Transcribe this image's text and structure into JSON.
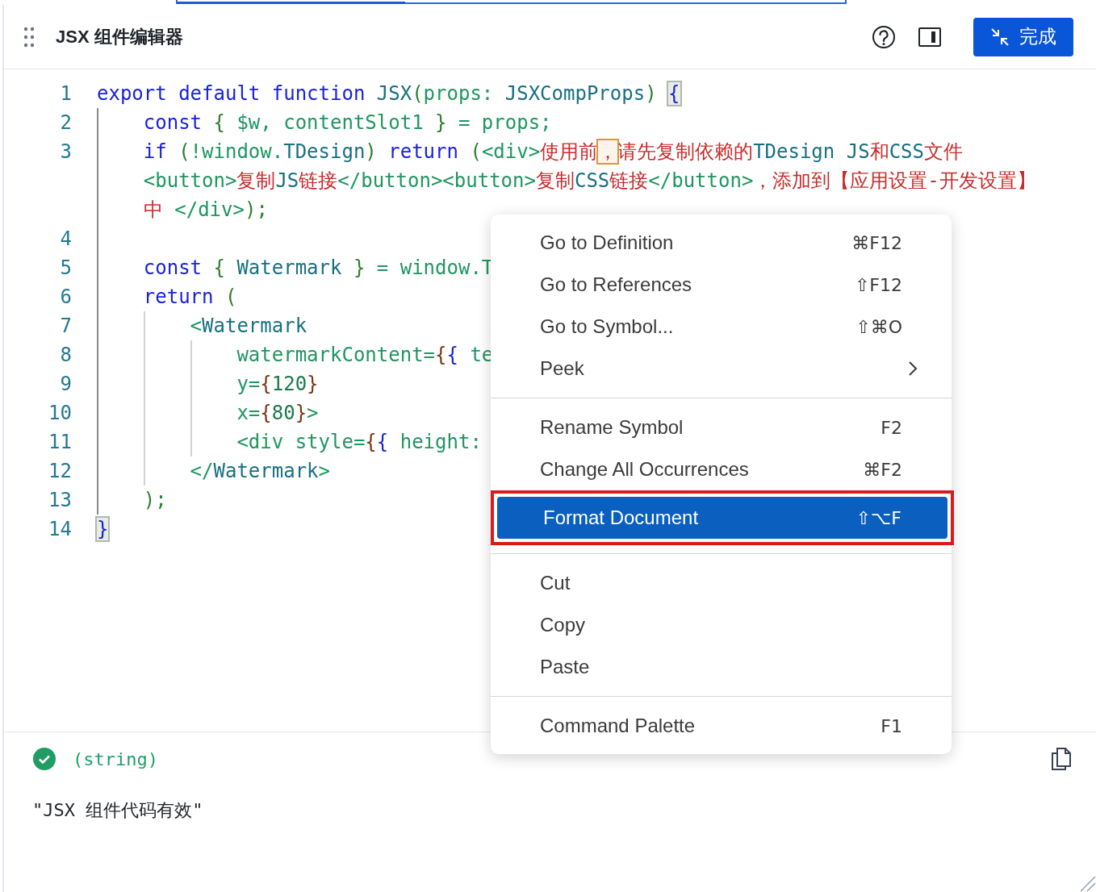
{
  "header": {
    "title": "JSX 组件编辑器",
    "done_button": "完成"
  },
  "editor": {
    "lines": [
      {
        "number": "1",
        "wraps": [
          {
            "tokens": [
              {
                "kind": "keyword",
                "text": "export default function "
              },
              {
                "kind": "name",
                "text": "JSX"
              },
              {
                "kind": "punct",
                "text": "("
              },
              {
                "kind": "code",
                "text": "props: "
              },
              {
                "kind": "name",
                "text": "JSXCompProps"
              },
              {
                "kind": "punct",
                "text": ") "
              },
              {
                "kind": "bracket-match",
                "text": "{"
              }
            ]
          }
        ]
      },
      {
        "number": "2",
        "wraps": [
          {
            "tokens": [
              {
                "kind": "keyword",
                "text": "    const"
              },
              {
                "kind": "punct",
                "text": " { "
              },
              {
                "kind": "code",
                "text": "$w, contentSlot1"
              },
              {
                "kind": "punct",
                "text": " }"
              },
              {
                "kind": "code",
                "text": " = props;"
              }
            ]
          }
        ]
      },
      {
        "number": "3",
        "wraps": [
          {
            "tokens": [
              {
                "kind": "keyword",
                "text": "    if"
              },
              {
                "kind": "punct",
                "text": " ("
              },
              {
                "kind": "code",
                "text": "!window."
              },
              {
                "kind": "name",
                "text": "TDesign"
              },
              {
                "kind": "punct",
                "text": ") "
              },
              {
                "kind": "keyword",
                "text": "return"
              },
              {
                "kind": "punct",
                "text": " ("
              },
              {
                "kind": "code",
                "text": "<div>"
              },
              {
                "kind": "text",
                "text": "使用前"
              },
              {
                "kind": "warning-char",
                "text": "，"
              },
              {
                "kind": "text",
                "text": "请先复制依赖的"
              },
              {
                "kind": "name",
                "text": "TDesign JS"
              },
              {
                "kind": "text",
                "text": "和"
              },
              {
                "kind": "name",
                "text": "CSS"
              },
              {
                "kind": "text",
                "text": "文件"
              }
            ]
          },
          {
            "tokens": [
              {
                "kind": "code",
                "text": "    <button>"
              },
              {
                "kind": "text",
                "text": "复制"
              },
              {
                "kind": "name",
                "text": "JS"
              },
              {
                "kind": "text",
                "text": "链接"
              },
              {
                "kind": "code",
                "text": "</button><button>"
              },
              {
                "kind": "text",
                "text": "复制"
              },
              {
                "kind": "name",
                "text": "CSS"
              },
              {
                "kind": "text",
                "text": "链接"
              },
              {
                "kind": "code",
                "text": "</button>"
              },
              {
                "kind": "text",
                "text": "，添加到【应用设置-开发设置】"
              }
            ]
          },
          {
            "tokens": [
              {
                "kind": "text",
                "text": "    中 "
              },
              {
                "kind": "code",
                "text": "</div>"
              },
              {
                "kind": "punct",
                "text": ");"
              }
            ]
          }
        ]
      },
      {
        "number": "4"
      },
      {
        "number": "5",
        "wraps": [
          {
            "tokens": [
              {
                "kind": "keyword",
                "text": "    const"
              },
              {
                "kind": "punct",
                "text": " { "
              },
              {
                "kind": "name",
                "text": "Watermark"
              },
              {
                "kind": "punct",
                "text": " }"
              },
              {
                "kind": "code",
                "text": " = window.T"
              }
            ]
          }
        ]
      },
      {
        "number": "6",
        "wraps": [
          {
            "tokens": [
              {
                "kind": "keyword",
                "text": "    return"
              },
              {
                "kind": "punct",
                "text": " ("
              }
            ]
          }
        ]
      },
      {
        "number": "7",
        "wraps": [
          {
            "tokens": [
              {
                "kind": "code",
                "text": "        <"
              },
              {
                "kind": "name",
                "text": "Watermark"
              }
            ]
          }
        ]
      },
      {
        "number": "8",
        "wraps": [
          {
            "tokens": [
              {
                "kind": "code",
                "text": "            watermarkContent="
              },
              {
                "kind": "outer-brace",
                "text": "{"
              },
              {
                "kind": "inner-brace",
                "text": "{"
              },
              {
                "kind": "code",
                "text": " te"
              }
            ]
          }
        ]
      },
      {
        "number": "9",
        "wraps": [
          {
            "tokens": [
              {
                "kind": "code",
                "text": "            y="
              },
              {
                "kind": "outer-brace",
                "text": "{"
              },
              {
                "kind": "number",
                "text": "120"
              },
              {
                "kind": "outer-brace",
                "text": "}"
              }
            ]
          }
        ]
      },
      {
        "number": "10",
        "wraps": [
          {
            "tokens": [
              {
                "kind": "code",
                "text": "            x="
              },
              {
                "kind": "outer-brace",
                "text": "{"
              },
              {
                "kind": "number",
                "text": "80"
              },
              {
                "kind": "outer-brace",
                "text": "}"
              },
              {
                "kind": "code",
                "text": ">"
              }
            ]
          }
        ]
      },
      {
        "number": "11",
        "wraps": [
          {
            "tokens": [
              {
                "kind": "code",
                "text": "            <div style="
              },
              {
                "kind": "outer-brace",
                "text": "{"
              },
              {
                "kind": "inner-brace",
                "text": "{"
              },
              {
                "kind": "code",
                "text": " height:"
              }
            ]
          }
        ]
      },
      {
        "number": "12",
        "wraps": [
          {
            "tokens": [
              {
                "kind": "code",
                "text": "        </"
              },
              {
                "kind": "name",
                "text": "Watermark"
              },
              {
                "kind": "code",
                "text": ">"
              }
            ]
          }
        ]
      },
      {
        "number": "13",
        "wraps": [
          {
            "tokens": [
              {
                "kind": "punct",
                "text": "    );"
              }
            ]
          }
        ]
      },
      {
        "number": "14",
        "wraps": [
          {
            "tokens": [
              {
                "kind": "bracket-match",
                "text": "}"
              }
            ]
          }
        ]
      }
    ]
  },
  "context_menu": {
    "items": [
      {
        "kind": "item",
        "label": "Go to Definition",
        "shortcut": "⌘F12",
        "selected": false,
        "annotated": false
      },
      {
        "kind": "item",
        "label": "Go to References",
        "shortcut": "⇧F12",
        "selected": false,
        "annotated": false
      },
      {
        "kind": "item",
        "label": "Go to Symbol...",
        "shortcut": "⇧⌘O",
        "selected": false,
        "annotated": false
      },
      {
        "kind": "submenu",
        "label": "Peek",
        "selected": false,
        "annotated": false
      },
      {
        "kind": "separator"
      },
      {
        "kind": "item",
        "label": "Rename Symbol",
        "shortcut": "F2",
        "selected": false,
        "annotated": false
      },
      {
        "kind": "item",
        "label": "Change All Occurrences",
        "shortcut": "⌘F2",
        "selected": false,
        "annotated": false
      },
      {
        "kind": "item",
        "label": "Format Document",
        "shortcut": "⇧⌥F",
        "selected": true,
        "annotated": true
      },
      {
        "kind": "separator"
      },
      {
        "kind": "item",
        "label": "Cut",
        "selected": false,
        "annotated": false
      },
      {
        "kind": "item",
        "label": "Copy",
        "selected": false,
        "annotated": false
      },
      {
        "kind": "item",
        "label": "Paste",
        "selected": false,
        "annotated": false
      },
      {
        "kind": "separator"
      },
      {
        "kind": "item",
        "label": "Command Palette",
        "shortcut": "F1",
        "selected": false,
        "annotated": false
      }
    ]
  },
  "result": {
    "valid": true,
    "type": "(string)",
    "value": "\"JSX 组件代码有效\""
  }
}
